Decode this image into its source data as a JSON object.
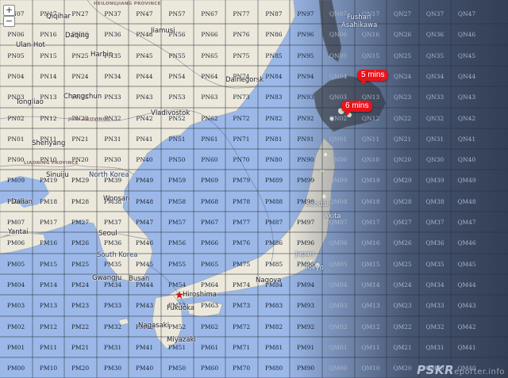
{
  "map": {
    "controls": {
      "zoom_in": "+",
      "zoom_out": "−"
    },
    "columns": [
      "PN0",
      "PN1",
      "PN2",
      "PN3",
      "PN4",
      "PN5",
      "PN6",
      "PN7",
      "PN8",
      "PN9",
      "QN0",
      "QN1",
      "QN2",
      "QN3",
      "QN4"
    ],
    "rows": [
      "7",
      "6",
      "5",
      "4",
      "3",
      "2",
      "1",
      "0",
      "9",
      "8",
      "7",
      "6",
      "5",
      "4",
      "3",
      "2",
      "1",
      "0"
    ],
    "column_row_groups": [
      "PN",
      "PN",
      "PN",
      "PN",
      "PN",
      "PN",
      "PN",
      "PN",
      "PN",
      "PN",
      "PN",
      "PN",
      "PN",
      "PN",
      "PN",
      "PN",
      "PN",
      "PN"
    ],
    "row_locator_letters": [
      "N",
      "N",
      "N",
      "N",
      "N",
      "N",
      "N",
      "N",
      "M",
      "M",
      "M",
      "M",
      "M",
      "M",
      "M",
      "M",
      "M",
      "M"
    ],
    "provinces": [
      {
        "name": "HEILONGJIANG PROVINCE"
      },
      {
        "name": "JILIN PROVINCE"
      },
      {
        "name": "LIAONING PROVINCE"
      }
    ],
    "places": [
      {
        "name": "Qiqihar",
        "cls": ""
      },
      {
        "name": "Daqing",
        "cls": ""
      },
      {
        "name": "Ulan Hot",
        "cls": ""
      },
      {
        "name": "Harbin",
        "cls": ""
      },
      {
        "name": "Jiamusi",
        "cls": ""
      },
      {
        "name": "Fushan",
        "cls": "light"
      },
      {
        "name": "Asahikawa",
        "cls": "light"
      },
      {
        "name": "Dalnegorsk",
        "cls": ""
      },
      {
        "name": "Tongliao",
        "cls": ""
      },
      {
        "name": "Changchun",
        "cls": ""
      },
      {
        "name": "Vladivostok",
        "cls": ""
      },
      {
        "name": "Shenyang",
        "cls": ""
      },
      {
        "name": "North Korea",
        "cls": "blue"
      },
      {
        "name": "Sinuiju",
        "cls": ""
      },
      {
        "name": "Wonsan",
        "cls": ""
      },
      {
        "name": "Dalian",
        "cls": ""
      },
      {
        "name": "Sendai",
        "cls": "light"
      },
      {
        "name": "Akita",
        "cls": "light"
      },
      {
        "name": "Yantai",
        "cls": ""
      },
      {
        "name": "Seoul",
        "cls": ""
      },
      {
        "name": "South Korea",
        "cls": "blue"
      },
      {
        "name": "Japan",
        "cls": "light"
      },
      {
        "name": "Tokyo",
        "cls": "light"
      },
      {
        "name": "Nagoya",
        "cls": ""
      },
      {
        "name": "Gwangju",
        "cls": ""
      },
      {
        "name": "Busan",
        "cls": ""
      },
      {
        "name": "Hiroshima",
        "cls": ""
      },
      {
        "name": "Fukuoka",
        "cls": ""
      },
      {
        "name": "Nagasaki",
        "cls": ""
      },
      {
        "name": "Miyazaki",
        "cls": ""
      }
    ],
    "spots": [
      {
        "label": "5 mins"
      },
      {
        "label": "6 mins"
      }
    ],
    "watermark": {
      "brand": "PSKR",
      "tail": "eporter.info"
    },
    "colors": {
      "sea": "#9bb8e8",
      "land": "#ece9dc",
      "night": "#2a3448",
      "spot": "#e8141c"
    }
  }
}
